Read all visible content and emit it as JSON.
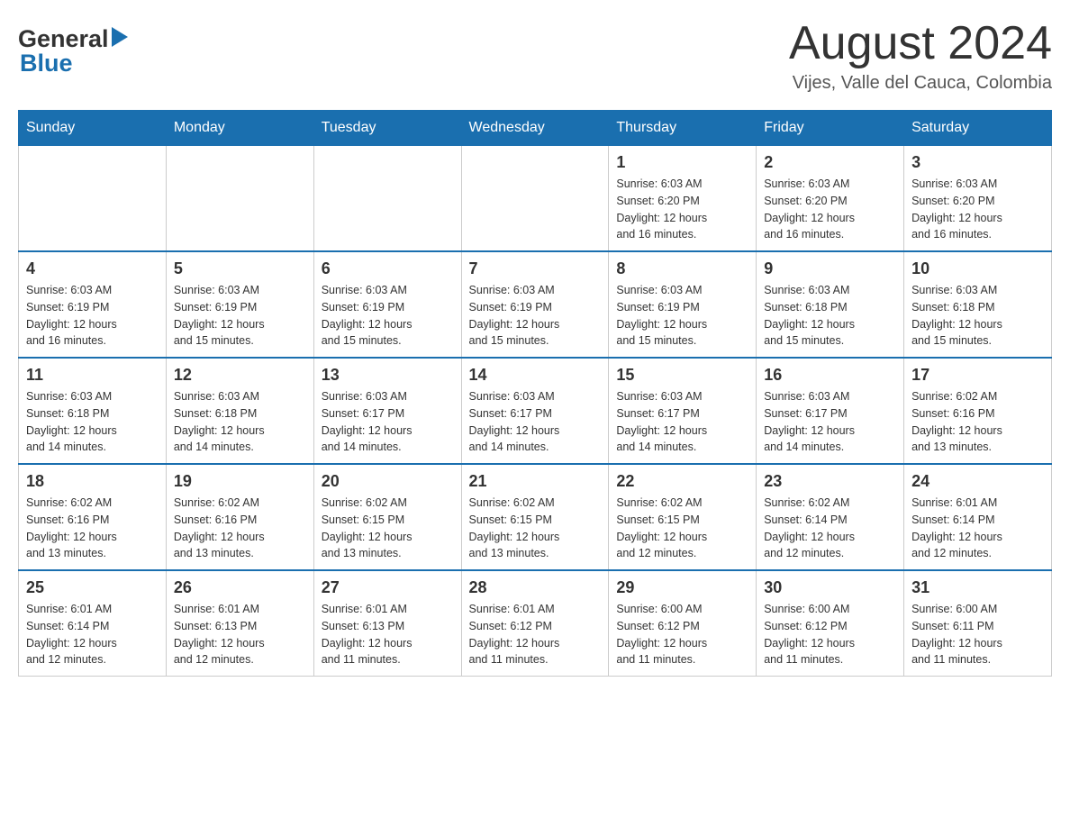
{
  "header": {
    "logo_general": "General",
    "logo_blue": "Blue",
    "month_title": "August 2024",
    "location": "Vijes, Valle del Cauca, Colombia"
  },
  "days_of_week": [
    "Sunday",
    "Monday",
    "Tuesday",
    "Wednesday",
    "Thursday",
    "Friday",
    "Saturday"
  ],
  "weeks": [
    {
      "days": [
        {
          "number": "",
          "info": ""
        },
        {
          "number": "",
          "info": ""
        },
        {
          "number": "",
          "info": ""
        },
        {
          "number": "",
          "info": ""
        },
        {
          "number": "1",
          "info": "Sunrise: 6:03 AM\nSunset: 6:20 PM\nDaylight: 12 hours\nand 16 minutes."
        },
        {
          "number": "2",
          "info": "Sunrise: 6:03 AM\nSunset: 6:20 PM\nDaylight: 12 hours\nand 16 minutes."
        },
        {
          "number": "3",
          "info": "Sunrise: 6:03 AM\nSunset: 6:20 PM\nDaylight: 12 hours\nand 16 minutes."
        }
      ]
    },
    {
      "days": [
        {
          "number": "4",
          "info": "Sunrise: 6:03 AM\nSunset: 6:19 PM\nDaylight: 12 hours\nand 16 minutes."
        },
        {
          "number": "5",
          "info": "Sunrise: 6:03 AM\nSunset: 6:19 PM\nDaylight: 12 hours\nand 15 minutes."
        },
        {
          "number": "6",
          "info": "Sunrise: 6:03 AM\nSunset: 6:19 PM\nDaylight: 12 hours\nand 15 minutes."
        },
        {
          "number": "7",
          "info": "Sunrise: 6:03 AM\nSunset: 6:19 PM\nDaylight: 12 hours\nand 15 minutes."
        },
        {
          "number": "8",
          "info": "Sunrise: 6:03 AM\nSunset: 6:19 PM\nDaylight: 12 hours\nand 15 minutes."
        },
        {
          "number": "9",
          "info": "Sunrise: 6:03 AM\nSunset: 6:18 PM\nDaylight: 12 hours\nand 15 minutes."
        },
        {
          "number": "10",
          "info": "Sunrise: 6:03 AM\nSunset: 6:18 PM\nDaylight: 12 hours\nand 15 minutes."
        }
      ]
    },
    {
      "days": [
        {
          "number": "11",
          "info": "Sunrise: 6:03 AM\nSunset: 6:18 PM\nDaylight: 12 hours\nand 14 minutes."
        },
        {
          "number": "12",
          "info": "Sunrise: 6:03 AM\nSunset: 6:18 PM\nDaylight: 12 hours\nand 14 minutes."
        },
        {
          "number": "13",
          "info": "Sunrise: 6:03 AM\nSunset: 6:17 PM\nDaylight: 12 hours\nand 14 minutes."
        },
        {
          "number": "14",
          "info": "Sunrise: 6:03 AM\nSunset: 6:17 PM\nDaylight: 12 hours\nand 14 minutes."
        },
        {
          "number": "15",
          "info": "Sunrise: 6:03 AM\nSunset: 6:17 PM\nDaylight: 12 hours\nand 14 minutes."
        },
        {
          "number": "16",
          "info": "Sunrise: 6:03 AM\nSunset: 6:17 PM\nDaylight: 12 hours\nand 14 minutes."
        },
        {
          "number": "17",
          "info": "Sunrise: 6:02 AM\nSunset: 6:16 PM\nDaylight: 12 hours\nand 13 minutes."
        }
      ]
    },
    {
      "days": [
        {
          "number": "18",
          "info": "Sunrise: 6:02 AM\nSunset: 6:16 PM\nDaylight: 12 hours\nand 13 minutes."
        },
        {
          "number": "19",
          "info": "Sunrise: 6:02 AM\nSunset: 6:16 PM\nDaylight: 12 hours\nand 13 minutes."
        },
        {
          "number": "20",
          "info": "Sunrise: 6:02 AM\nSunset: 6:15 PM\nDaylight: 12 hours\nand 13 minutes."
        },
        {
          "number": "21",
          "info": "Sunrise: 6:02 AM\nSunset: 6:15 PM\nDaylight: 12 hours\nand 13 minutes."
        },
        {
          "number": "22",
          "info": "Sunrise: 6:02 AM\nSunset: 6:15 PM\nDaylight: 12 hours\nand 12 minutes."
        },
        {
          "number": "23",
          "info": "Sunrise: 6:02 AM\nSunset: 6:14 PM\nDaylight: 12 hours\nand 12 minutes."
        },
        {
          "number": "24",
          "info": "Sunrise: 6:01 AM\nSunset: 6:14 PM\nDaylight: 12 hours\nand 12 minutes."
        }
      ]
    },
    {
      "days": [
        {
          "number": "25",
          "info": "Sunrise: 6:01 AM\nSunset: 6:14 PM\nDaylight: 12 hours\nand 12 minutes."
        },
        {
          "number": "26",
          "info": "Sunrise: 6:01 AM\nSunset: 6:13 PM\nDaylight: 12 hours\nand 12 minutes."
        },
        {
          "number": "27",
          "info": "Sunrise: 6:01 AM\nSunset: 6:13 PM\nDaylight: 12 hours\nand 11 minutes."
        },
        {
          "number": "28",
          "info": "Sunrise: 6:01 AM\nSunset: 6:12 PM\nDaylight: 12 hours\nand 11 minutes."
        },
        {
          "number": "29",
          "info": "Sunrise: 6:00 AM\nSunset: 6:12 PM\nDaylight: 12 hours\nand 11 minutes."
        },
        {
          "number": "30",
          "info": "Sunrise: 6:00 AM\nSunset: 6:12 PM\nDaylight: 12 hours\nand 11 minutes."
        },
        {
          "number": "31",
          "info": "Sunrise: 6:00 AM\nSunset: 6:11 PM\nDaylight: 12 hours\nand 11 minutes."
        }
      ]
    }
  ]
}
